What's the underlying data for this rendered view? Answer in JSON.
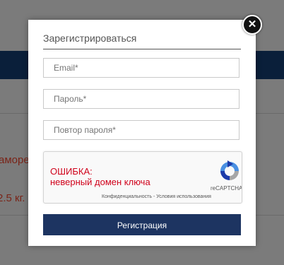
{
  "background": {
    "text_1": "аморе",
    "text_2": "2.5 кг."
  },
  "modal": {
    "title": "Зарегистрироваться",
    "close_icon": "close-icon",
    "fields": {
      "email_placeholder": "Email*",
      "password_placeholder": "Пароль*",
      "password_repeat_placeholder": "Повтор пароля*"
    },
    "recaptcha": {
      "error_line1": "ОШИБКА:",
      "error_line2": "неверный домен ключа",
      "brand": "reCAPTCHA",
      "privacy": "Конфиденциальность",
      "separator": " - ",
      "terms": "Условия использования"
    },
    "submit_label": "Регистрация"
  },
  "colors": {
    "submit_bg": "#1d3461",
    "error_text": "#d0021b"
  }
}
